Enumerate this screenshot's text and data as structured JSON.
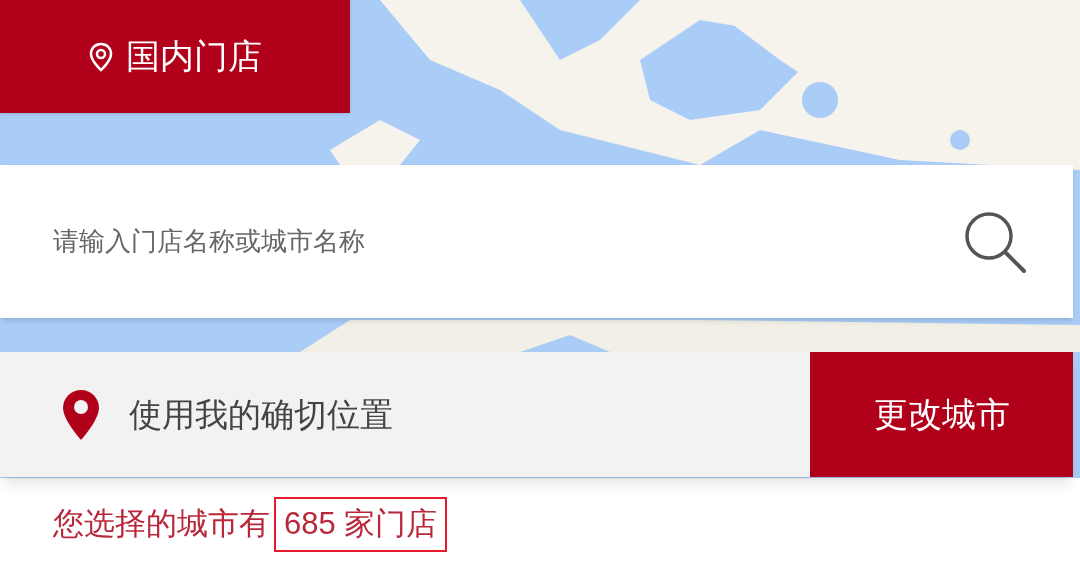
{
  "tab": {
    "label": "国内门店",
    "selected": true
  },
  "search": {
    "placeholder": "请输入门店名称或城市名称"
  },
  "location": {
    "label": "使用我的确切位置"
  },
  "change_city_button": "更改城市",
  "result": {
    "prefix": "您选择的城市有",
    "count": "685 家门店",
    "highlighted": true
  }
}
